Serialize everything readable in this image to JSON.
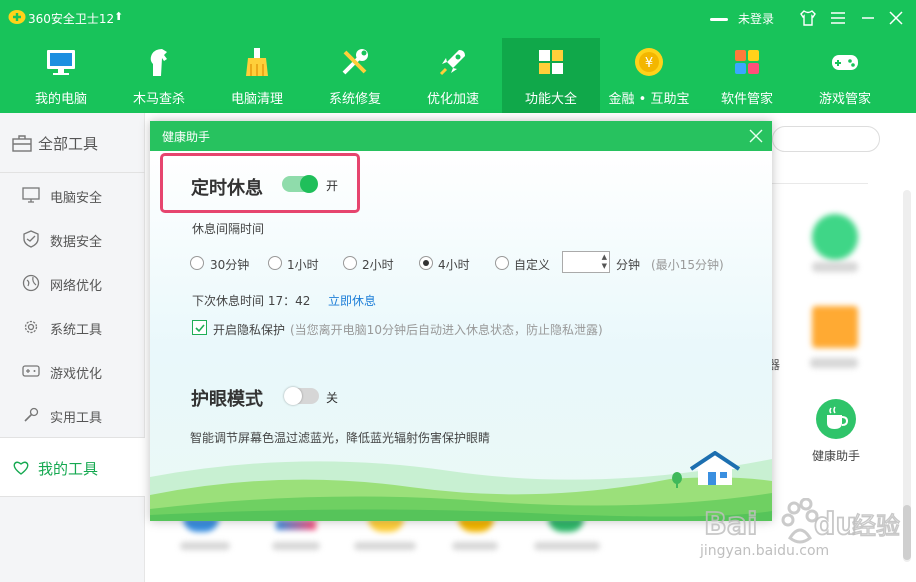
{
  "app": {
    "title": "360安全卫士12",
    "login_label": "未登录"
  },
  "nav": [
    {
      "label": "我的电脑",
      "icon": "monitor-icon"
    },
    {
      "label": "木马查杀",
      "icon": "horse-icon"
    },
    {
      "label": "电脑清理",
      "icon": "broom-icon"
    },
    {
      "label": "系统修复",
      "icon": "wrench-icon"
    },
    {
      "label": "优化加速",
      "icon": "rocket-icon"
    },
    {
      "label": "功能大全",
      "icon": "grid-icon",
      "active": true
    },
    {
      "label": "金融 • 互助宝",
      "icon": "coin-icon"
    },
    {
      "label": "软件管家",
      "icon": "apps-icon"
    },
    {
      "label": "游戏管家",
      "icon": "gamepad-icon"
    }
  ],
  "sidebar": {
    "all_tools": "全部工具",
    "items": [
      {
        "label": "电脑安全",
        "icon": "monitor-icon"
      },
      {
        "label": "数据安全",
        "icon": "shield-icon"
      },
      {
        "label": "网络优化",
        "icon": "globe-icon"
      },
      {
        "label": "系统工具",
        "icon": "gear-icon"
      },
      {
        "label": "游戏优化",
        "icon": "gamepad-icon"
      },
      {
        "label": "实用工具",
        "icon": "wrench-icon"
      }
    ],
    "my_tools": "我的工具"
  },
  "background": {
    "health_tool_label": "健康助手",
    "partial_glyph": "器"
  },
  "dialog": {
    "title": "健康助手",
    "rest": {
      "title": "定时休息",
      "toggle_state": "开",
      "enabled": true,
      "interval_label": "休息间隔时间",
      "options": [
        "30分钟",
        "1小时",
        "2小时",
        "4小时",
        "自定义"
      ],
      "selected": "4小时",
      "custom_unit": "分钟",
      "custom_hint": "(最小15分钟)",
      "next_rest_label": "下次休息时间 17：42",
      "rest_now_link": "立即休息",
      "privacy_label": "开启隐私保护",
      "privacy_hint": "(当您离开电脑10分钟后自动进入休息状态，防止隐私泄露)",
      "privacy_checked": true
    },
    "eye": {
      "title": "护眼模式",
      "toggle_state": "关",
      "enabled": false,
      "description": "智能调节屏幕色温过滤蓝光，降低蓝光辐射伤害保护眼睛"
    }
  },
  "watermark": {
    "text": "jingyan.baidu.com"
  },
  "colors": {
    "brand_green": "#18c35a",
    "active_nav": "#10a84a",
    "link_blue": "#1f7fd8",
    "highlight_pink": "#e6456e"
  }
}
